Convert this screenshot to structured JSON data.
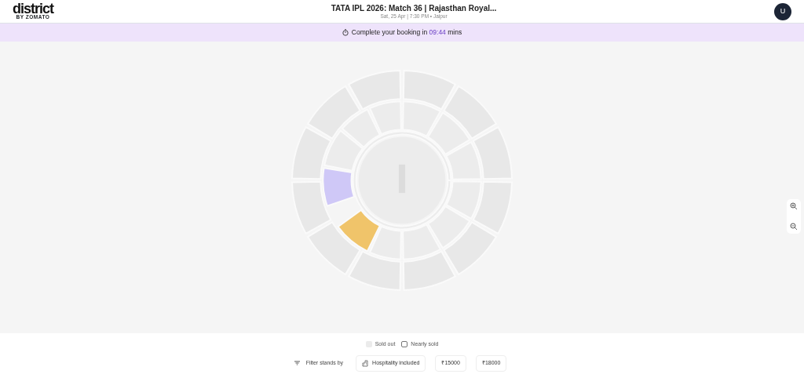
{
  "header": {
    "logo": "district",
    "logo_sub": "BY ZOMATO",
    "title": "TATA IPL 2026: Match 36 | Rajasthan Royal...",
    "subtitle": "Sat, 25 Apr | 7:30 PM • Jaipur",
    "avatar": "U"
  },
  "banner": {
    "text": "Complete your booking in",
    "timer": "09:44",
    "unit": "mins"
  },
  "stadium": {
    "highlighted_stands": [
      {
        "color": "#cfc8f7"
      },
      {
        "color": "#f0c46a"
      }
    ]
  },
  "legend": [
    {
      "kind": "filled",
      "label": "Sold out"
    },
    {
      "kind": "outline",
      "label": "Nearly sold"
    }
  ],
  "filters": {
    "label": "Filter stands by",
    "chips": [
      {
        "kind": "icon",
        "label": "Hospitality included"
      },
      {
        "kind": "plain",
        "label": "₹15000"
      },
      {
        "kind": "plain",
        "label": "₹18000"
      }
    ]
  }
}
